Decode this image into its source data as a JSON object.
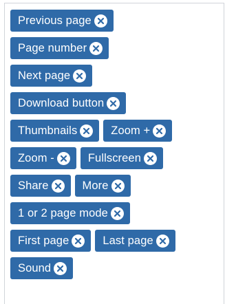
{
  "chips": {
    "previous_page": "Previous page",
    "page_number": "Page number",
    "next_page": "Next page",
    "download_button": "Download button",
    "thumbnails": "Thumbnails",
    "zoom_plus": "Zoom +",
    "zoom_minus": "Zoom -",
    "fullscreen": "Fullscreen",
    "share": "Share",
    "more": "More",
    "page_mode": "1 or 2 page mode",
    "first_page": "First page",
    "last_page": "Last page",
    "sound": "Sound"
  },
  "colors": {
    "chip_background": "#2f6aa8",
    "chip_text": "#ffffff",
    "remove_icon_background": "#ffffff",
    "remove_icon_cross": "#2f6aa8"
  },
  "icons": {
    "remove": "close-circle-icon"
  }
}
